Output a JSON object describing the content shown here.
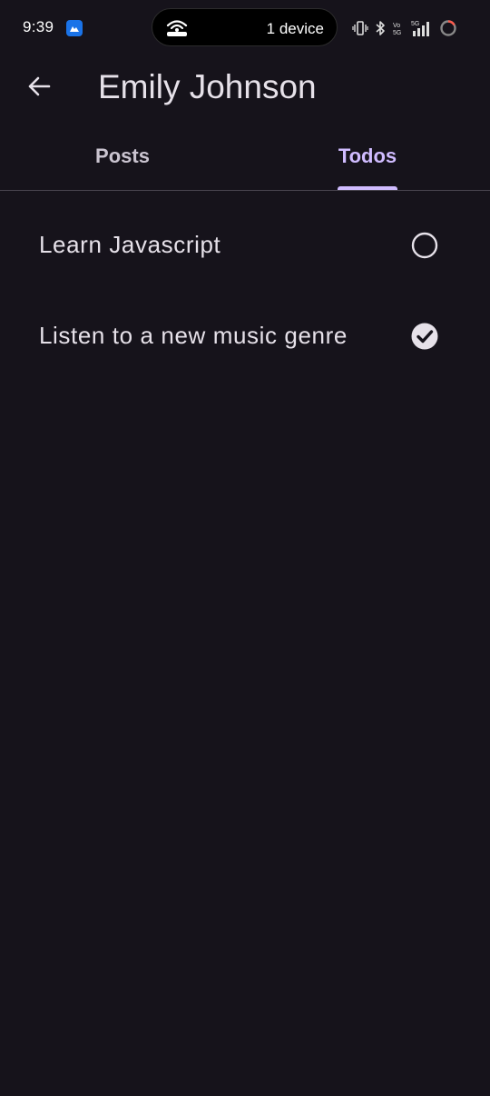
{
  "status_bar": {
    "time": "9:39",
    "island_text": "1 device",
    "icons": [
      "app-notification-icon",
      "hotspot-icon",
      "vibrate-icon",
      "bluetooth-icon",
      "volte-icon",
      "signal-5g-icon",
      "battery-ring-icon"
    ],
    "network_label": "5G",
    "volte_label": "Vo 5G"
  },
  "app_bar": {
    "title": "Emily Johnson",
    "back_icon": "arrow-back-icon"
  },
  "tabs": [
    {
      "label": "Posts",
      "selected": false
    },
    {
      "label": "Todos",
      "selected": true
    }
  ],
  "todos": [
    {
      "title": "Learn Javascript",
      "completed": false
    },
    {
      "title": "Listen to a new music genre",
      "completed": true
    }
  ],
  "colors": {
    "background": "#16131b",
    "text": "#e6e1e9",
    "tab_active": "#d0bcff",
    "tab_inactive": "#cac4d0",
    "divider": "#49454f"
  }
}
